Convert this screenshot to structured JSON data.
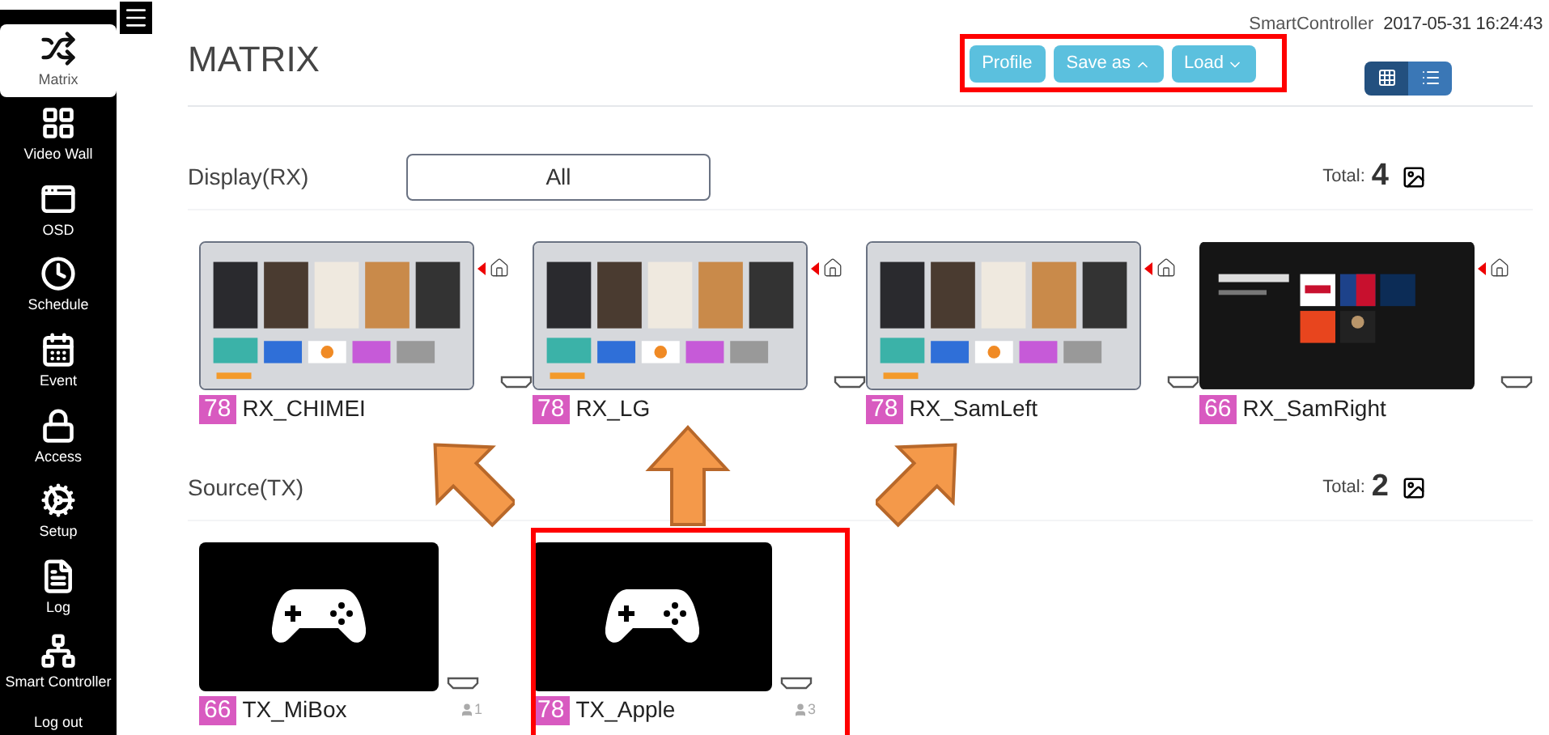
{
  "sidebar": {
    "items": [
      {
        "label": "Matrix",
        "selected": true
      },
      {
        "label": "Video Wall",
        "selected": false
      },
      {
        "label": "OSD",
        "selected": false
      },
      {
        "label": "Schedule",
        "selected": false
      },
      {
        "label": "Event",
        "selected": false
      },
      {
        "label": "Access",
        "selected": false
      },
      {
        "label": "Setup",
        "selected": false
      },
      {
        "label": "Log",
        "selected": false
      },
      {
        "label": "Smart Controller",
        "selected": false
      }
    ],
    "logout": "Log out"
  },
  "header": {
    "title": "MATRIX",
    "buttons": [
      {
        "label": "Profile",
        "kind": "plain"
      },
      {
        "label": "Save as",
        "kind": "dropup"
      },
      {
        "label": "Load",
        "kind": "dropdown"
      }
    ],
    "user": "SmartController",
    "datetime": "2017-05-31 16:24:43",
    "views": [
      {
        "kind": "grid",
        "selected": true
      },
      {
        "kind": "list",
        "selected": false
      }
    ]
  },
  "display": {
    "title": "Display(RX)",
    "filter": "All",
    "total_label": "Total:",
    "total": "4",
    "devices": [
      {
        "badge": "78",
        "name": "RX_CHIMEI"
      },
      {
        "badge": "78",
        "name": "RX_LG"
      },
      {
        "badge": "78",
        "name": "RX_SamLeft"
      },
      {
        "badge": "66",
        "name": "RX_SamRight"
      }
    ]
  },
  "source": {
    "title": "Source(TX)",
    "total_label": "Total:",
    "total": "2",
    "devices": [
      {
        "badge": "66",
        "name": "TX_MiBox",
        "users": "1"
      },
      {
        "badge": "78",
        "name": "TX_Apple",
        "users": "3"
      }
    ]
  }
}
